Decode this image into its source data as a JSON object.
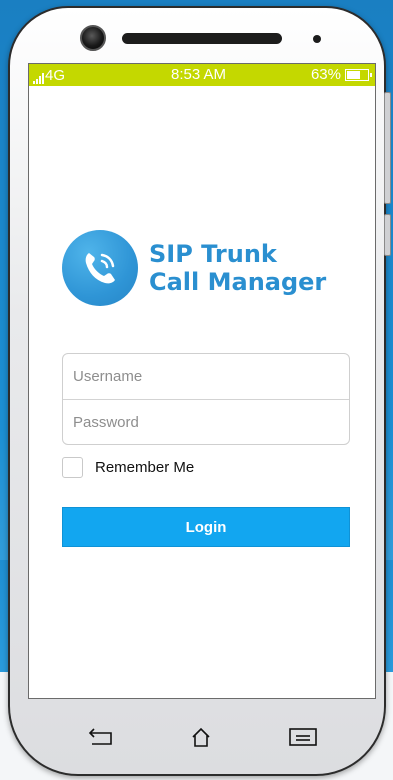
{
  "status_bar": {
    "network": "4G",
    "time": "8:53 AM",
    "battery": "63%",
    "battery_level": 0.63,
    "color": "#c4d800"
  },
  "logo": {
    "icon": "phone-handset-icon",
    "line1": "SIP Trunk",
    "line2": "Call Manager",
    "color": "#2a8fd0"
  },
  "login_form": {
    "username_placeholder": "Username",
    "username_value": "",
    "password_placeholder": "Password",
    "password_value": "",
    "remember_label": "Remember Me",
    "remember_checked": false,
    "login_label": "Login",
    "login_color": "#12a6f0"
  },
  "nav_bar": {
    "back_icon": "back-arrow-icon",
    "home_icon": "home-icon",
    "menu_icon": "menu-icon"
  }
}
